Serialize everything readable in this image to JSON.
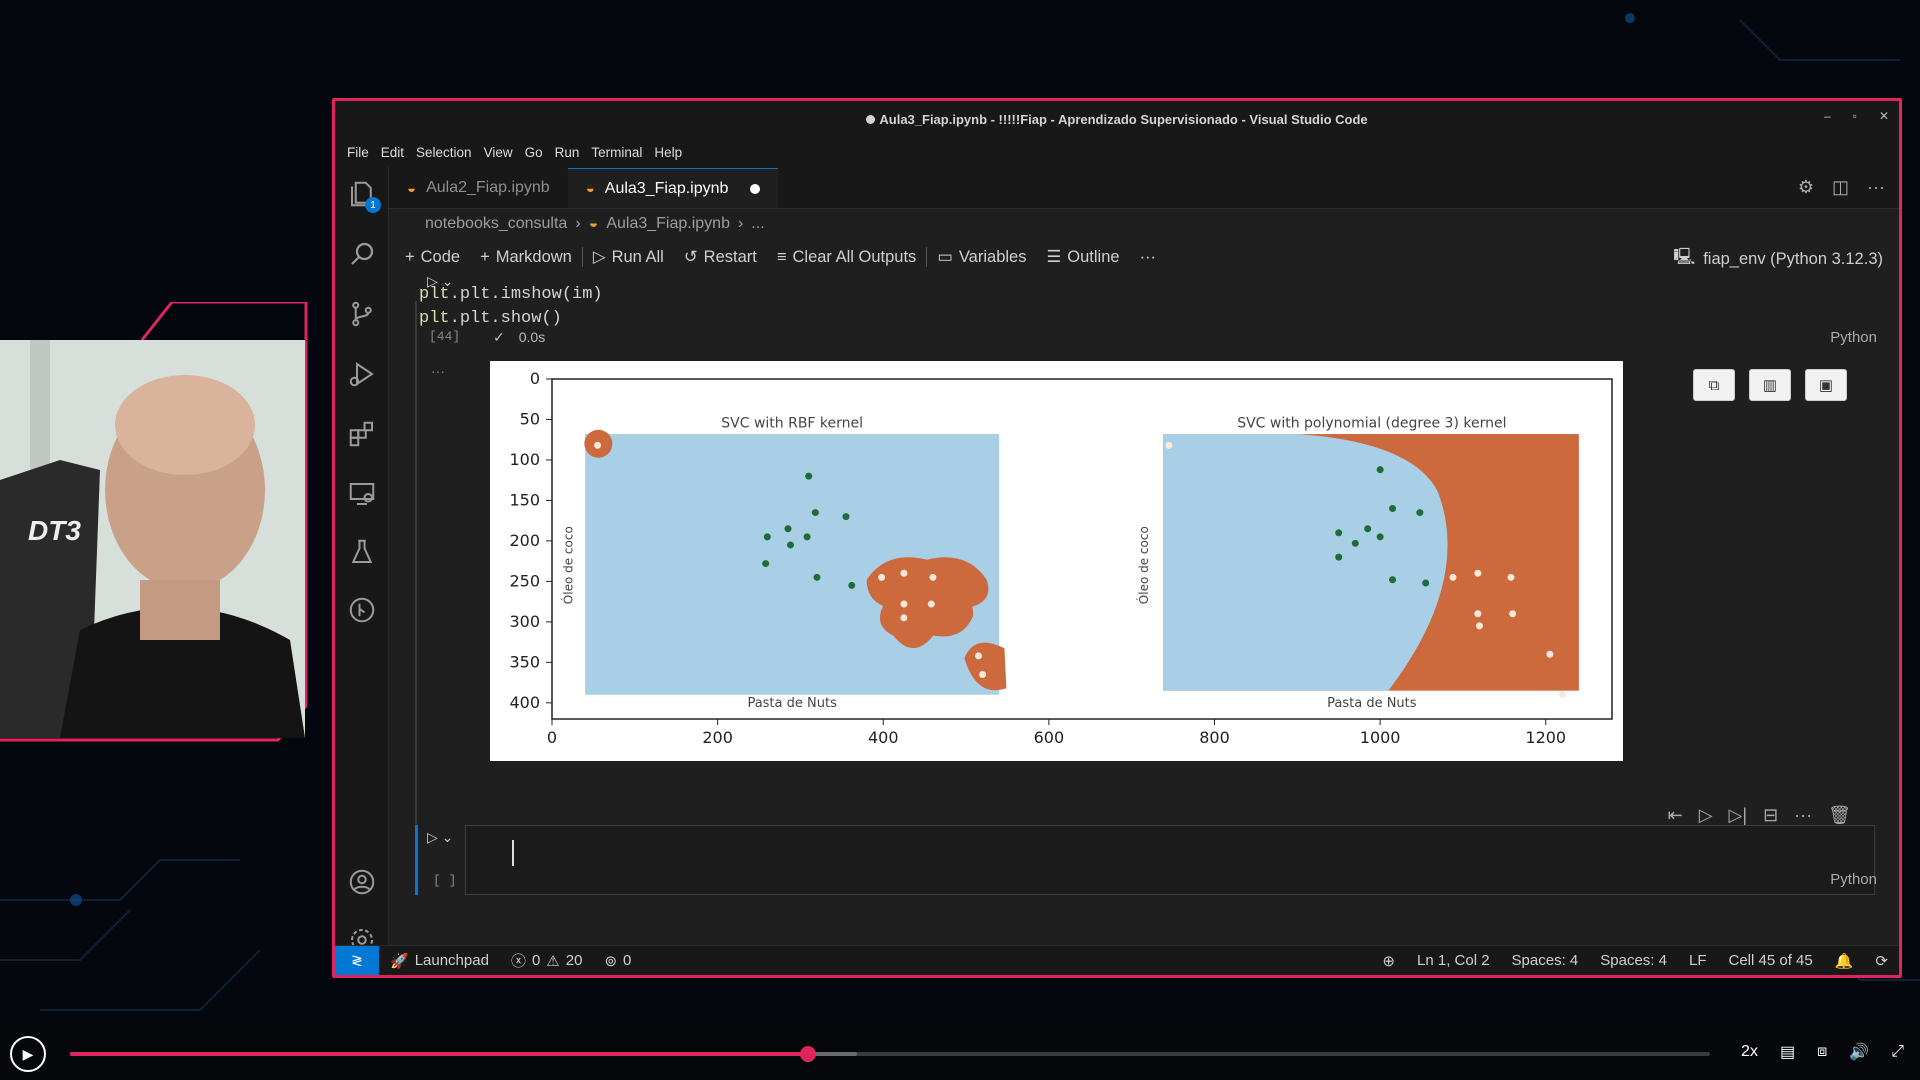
{
  "window": {
    "title": "Aula3_Fiap.ipynb - !!!!!Fiap - Aprendizado Supervisionado - Visual Studio Code",
    "controls": [
      "–",
      "▫",
      "✕"
    ]
  },
  "menu": [
    "File",
    "Edit",
    "Selection",
    "View",
    "Go",
    "Run",
    "Terminal",
    "Help"
  ],
  "explorer_badge": "1",
  "tabs": [
    {
      "label": "Aula2_Fiap.ipynb",
      "active": false
    },
    {
      "label": "Aula3_Fiap.ipynb",
      "active": true,
      "modified": true
    }
  ],
  "breadcrumb": [
    "notebooks_consulta",
    "Aula3_Fiap.ipynb",
    "..."
  ],
  "toolbar": {
    "code": "Code",
    "markdown": "Markdown",
    "run_all": "Run All",
    "restart": "Restart",
    "clear": "Clear All Outputs",
    "variables": "Variables",
    "outline": "Outline",
    "more": "···"
  },
  "kernel": "fiap_env (Python 3.12.3)",
  "cell1": {
    "code": [
      "plt.imshow(im)",
      "plt.show()"
    ],
    "exec_count": "[44]",
    "time": "0.0s",
    "language": "Python"
  },
  "cell2": {
    "exec_count": "[ ]",
    "language": "Python"
  },
  "status": {
    "launchpad": "Launchpad",
    "errors": "0",
    "warnings": "20",
    "ports": "0",
    "position": "Ln 1, Col 2",
    "spaces1": "Spaces: 4",
    "spaces2": "Spaces: 4",
    "eol": "LF",
    "cell": "Cell 45 of 45"
  },
  "player": {
    "speed": "2x",
    "progress": 0.45,
    "buffered": 0.48
  },
  "chart_data": {
    "type": "image",
    "xticks": [
      0,
      200,
      400,
      600,
      800,
      1000,
      1200
    ],
    "yticks": [
      0,
      50,
      100,
      150,
      200,
      250,
      300,
      350,
      400
    ],
    "xlim": [
      0,
      1280
    ],
    "ylim": [
      420,
      0
    ],
    "panels": [
      {
        "title": "SVC with RBF kernel",
        "xlabel": "Pasta de Nuts",
        "ylabel": "Óleo de coco",
        "region_colors": {
          "class_a": "#a9cfe6",
          "class_b": "#cc6a3e"
        },
        "points": {
          "class_a": [
            [
              310,
              120
            ],
            [
              260,
              195
            ],
            [
              285,
              185
            ],
            [
              288,
              205
            ],
            [
              308,
              195
            ],
            [
              318,
              165
            ],
            [
              355,
              170
            ],
            [
              320,
              245
            ],
            [
              362,
              255
            ],
            [
              258,
              228
            ]
          ],
          "class_b": [
            [
              55,
              82
            ],
            [
              398,
              245
            ],
            [
              425,
              240
            ],
            [
              460,
              245
            ],
            [
              425,
              278
            ],
            [
              425,
              295
            ],
            [
              458,
              278
            ],
            [
              515,
              342
            ],
            [
              520,
              365
            ]
          ]
        }
      },
      {
        "title": "SVC with polynomial (degree 3) kernel",
        "xlabel": "Pasta de Nuts",
        "ylabel": "Óleo de coco",
        "region_colors": {
          "class_a": "#a9cfe6",
          "class_b": "#cc6a3e"
        },
        "points": {
          "class_a": [
            [
              1000,
              112
            ],
            [
              1015,
              160
            ],
            [
              1048,
              165
            ],
            [
              985,
              185
            ],
            [
              950,
              190
            ],
            [
              1000,
              195
            ],
            [
              970,
              203
            ],
            [
              950,
              220
            ],
            [
              1015,
              248
            ],
            [
              1055,
              252
            ]
          ],
          "class_b": [
            [
              745,
              82
            ],
            [
              1088,
              245
            ],
            [
              1118,
              240
            ],
            [
              1158,
              245
            ],
            [
              1118,
              290
            ],
            [
              1120,
              305
            ],
            [
              1160,
              290
            ],
            [
              1205,
              340
            ],
            [
              1220,
              390
            ]
          ]
        }
      }
    ]
  }
}
